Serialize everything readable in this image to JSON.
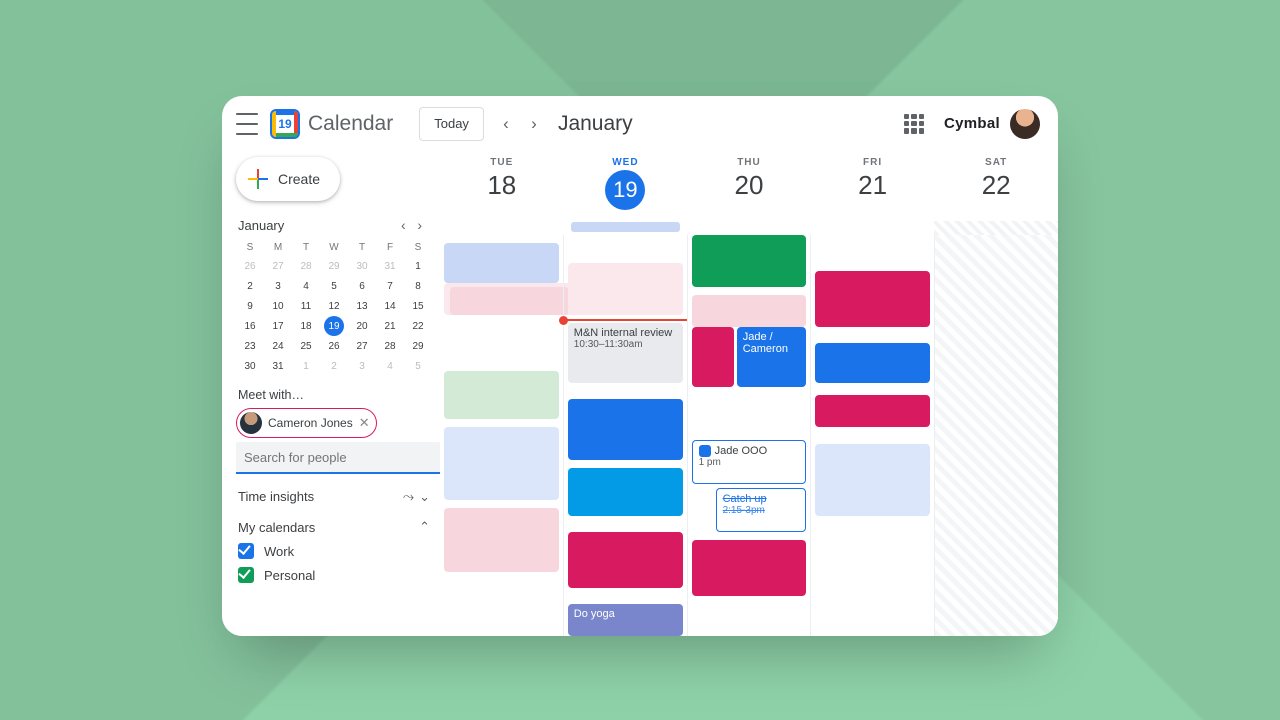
{
  "header": {
    "app_title": "Calendar",
    "logo_day": "19",
    "today_label": "Today",
    "month_label": "January",
    "brand": "Cymbal"
  },
  "sidebar": {
    "create_label": "Create",
    "mini": {
      "month_label": "January",
      "weekdays": [
        "S",
        "M",
        "T",
        "W",
        "T",
        "F",
        "S"
      ],
      "rows": [
        [
          {
            "n": "26",
            "dim": true
          },
          {
            "n": "27",
            "dim": true
          },
          {
            "n": "28",
            "dim": true
          },
          {
            "n": "29",
            "dim": true
          },
          {
            "n": "30",
            "dim": true
          },
          {
            "n": "31",
            "dim": true
          },
          {
            "n": "1"
          }
        ],
        [
          {
            "n": "2"
          },
          {
            "n": "3"
          },
          {
            "n": "4"
          },
          {
            "n": "5"
          },
          {
            "n": "6"
          },
          {
            "n": "7"
          },
          {
            "n": "8"
          }
        ],
        [
          {
            "n": "9"
          },
          {
            "n": "10"
          },
          {
            "n": "11"
          },
          {
            "n": "12"
          },
          {
            "n": "13"
          },
          {
            "n": "14"
          },
          {
            "n": "15"
          }
        ],
        [
          {
            "n": "16"
          },
          {
            "n": "17"
          },
          {
            "n": "18"
          },
          {
            "n": "19",
            "today": true
          },
          {
            "n": "20"
          },
          {
            "n": "21"
          },
          {
            "n": "22"
          }
        ],
        [
          {
            "n": "23"
          },
          {
            "n": "24"
          },
          {
            "n": "25"
          },
          {
            "n": "26"
          },
          {
            "n": "27"
          },
          {
            "n": "28"
          },
          {
            "n": "29"
          }
        ],
        [
          {
            "n": "30"
          },
          {
            "n": "31"
          },
          {
            "n": "1",
            "dim": true
          },
          {
            "n": "2",
            "dim": true
          },
          {
            "n": "3",
            "dim": true
          },
          {
            "n": "4",
            "dim": true
          },
          {
            "n": "5",
            "dim": true
          }
        ]
      ]
    },
    "meet_label": "Meet with…",
    "chip_name": "Cameron Jones",
    "search_placeholder": "Search for people",
    "time_insights_label": "Time insights",
    "my_calendars_label": "My calendars",
    "calendars": [
      {
        "label": "Work",
        "color": "blue"
      },
      {
        "label": "Personal",
        "color": "green"
      }
    ]
  },
  "week": {
    "days": [
      {
        "dow": "TUE",
        "num": "18",
        "off": false,
        "active": false
      },
      {
        "dow": "WED",
        "num": "19",
        "off": false,
        "active": true,
        "allday": true
      },
      {
        "dow": "THU",
        "num": "20",
        "off": false,
        "active": false
      },
      {
        "dow": "FRI",
        "num": "21",
        "off": false,
        "active": false
      },
      {
        "dow": "SAT",
        "num": "22",
        "off": true,
        "active": false
      }
    ],
    "now_pct": 21,
    "events": {
      "focus_title": "M&N internal review",
      "focus_time": "10:30–11:30am",
      "jade_label": "Jade / Cameron",
      "ooo_label": "Jade OOO",
      "ooo_time": "1 pm",
      "catchup_label": "Catch up",
      "catchup_time": "2:15-3pm",
      "yoga_label": "Do yoga"
    },
    "colors": {
      "magenta": "#d81b60",
      "blue": "#1a73e8",
      "skyblue": "#039be5",
      "lightblue": "#c7d7f5",
      "paleblue": "#dbe6fb",
      "pink": "#f7d7dd",
      "palepink": "#fbe8ec",
      "mint": "#d2ead6",
      "green": "#0f9d58",
      "indigo": "#7986cb",
      "grey": "#e8eaed"
    }
  }
}
